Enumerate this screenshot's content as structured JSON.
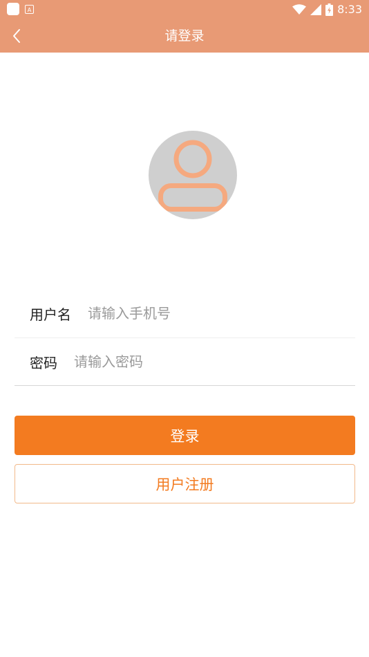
{
  "status_bar": {
    "time": "8:33",
    "icons": [
      "app-notification-icon",
      "a-keyboard-icon",
      "wifi-icon",
      "signal-icon",
      "battery-icon"
    ]
  },
  "app_bar": {
    "title": "请登录",
    "back_icon": "chevron-left-icon"
  },
  "avatar": {
    "icon": "user-avatar-icon"
  },
  "form": {
    "username": {
      "label": "用户名",
      "placeholder": "请输入手机号",
      "value": ""
    },
    "password": {
      "label": "密码",
      "placeholder": "请输入密码",
      "value": ""
    }
  },
  "buttons": {
    "login": "登录",
    "register": "用户注册"
  },
  "colors": {
    "header": "#E89A75",
    "primary": "#F37B20",
    "avatar_bg": "#CFCFCF",
    "avatar_figure": "#F5A97F"
  }
}
